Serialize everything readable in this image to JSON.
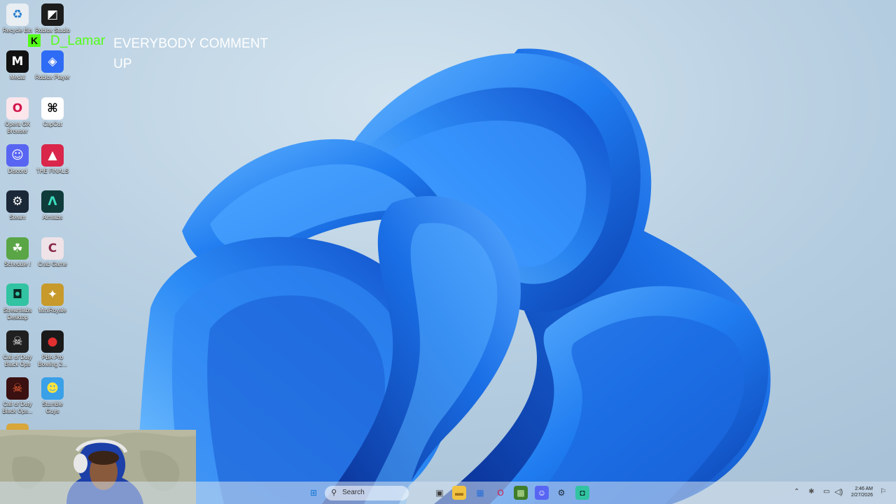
{
  "desktop": {
    "icons": [
      {
        "label": "Recycle Bin",
        "icon": "recycle-bin-icon",
        "glyph": "♻",
        "bg": "#e9eef3",
        "fg": "#2b7fd0"
      },
      {
        "label": "Roblox Studio",
        "icon": "roblox-studio-icon",
        "glyph": "◩",
        "bg": "#1c1c1c",
        "fg": "#ffffff"
      },
      {
        "label": "Medal",
        "icon": "medal-icon",
        "glyph": "M",
        "bg": "#111111",
        "fg": "#ffffff"
      },
      {
        "label": "Roblox Player",
        "icon": "roblox-player-icon",
        "glyph": "◈",
        "bg": "#2f6cf5",
        "fg": "#ffffff"
      },
      {
        "label": "Opera GX Browser",
        "icon": "opera-gx-icon",
        "glyph": "O",
        "bg": "#fbe6ec",
        "fg": "#d3164a"
      },
      {
        "label": "CapCut",
        "icon": "capcut-icon",
        "glyph": "⌘",
        "bg": "#ffffff",
        "fg": "#000000"
      },
      {
        "label": "Discord",
        "icon": "discord-icon",
        "glyph": "☺",
        "bg": "#5865f2",
        "fg": "#ffffff"
      },
      {
        "label": "THE FINALS",
        "icon": "the-finals-icon",
        "glyph": "▲",
        "bg": "#d9264a",
        "fg": "#ffffff"
      },
      {
        "label": "Steam",
        "icon": "steam-icon",
        "glyph": "⚙",
        "bg": "#1b2838",
        "fg": "#ffffff"
      },
      {
        "label": "Aimlabs",
        "icon": "aimlabs-icon",
        "glyph": "Λ",
        "bg": "#103b3b",
        "fg": "#3ce0c0"
      },
      {
        "label": "Schedule I",
        "icon": "schedule-one-icon",
        "glyph": "☘",
        "bg": "#5aa646",
        "fg": "#ffffff"
      },
      {
        "label": "Crab Game",
        "icon": "crab-game-icon",
        "glyph": "C",
        "bg": "#efe3e8",
        "fg": "#8a2a4a"
      },
      {
        "label": "Streamlabs Desktop",
        "icon": "streamlabs-icon",
        "glyph": "◘",
        "bg": "#31c3a2",
        "fg": "#0b2b25"
      },
      {
        "label": "MiniRoyale",
        "icon": "miniroyale-icon",
        "glyph": "✦",
        "bg": "#c79a2b",
        "fg": "#ffffff"
      },
      {
        "label": "Call of Duty Black Ops",
        "icon": "cod-black-ops-icon",
        "glyph": "☠",
        "bg": "#202020",
        "fg": "#ffffff"
      },
      {
        "label": "PBA Pro Bowling 2...",
        "icon": "pba-bowling-icon",
        "glyph": "●",
        "bg": "#1a1a1a",
        "fg": "#e03030"
      },
      {
        "label": "Call of Duty Black Ops...",
        "icon": "cod-black-ops-2-icon",
        "glyph": "☠",
        "bg": "#3a1010",
        "fg": "#ff6a3a"
      },
      {
        "label": "Stumble Guys",
        "icon": "stumble-guys-icon",
        "glyph": "☻",
        "bg": "#3aa0e8",
        "fg": "#ffe43a"
      },
      {
        "label": "",
        "icon": "folder-icon",
        "glyph": "▤",
        "bg": "#d8a63a",
        "fg": "#6b4a0a"
      }
    ]
  },
  "chat": {
    "badge": "K",
    "username": "D_Lamar",
    "message": "EVERYBODY COMMENT UP"
  },
  "taskbar": {
    "search_placeholder": "Search",
    "apps": [
      {
        "name": "start-button",
        "icon": "windows-logo-icon",
        "glyph": "⊞",
        "bg": "transparent",
        "fg": "#1677d6"
      },
      {
        "name": "task-view-button",
        "icon": "task-view-icon",
        "glyph": "▣",
        "bg": "transparent",
        "fg": "#404040"
      },
      {
        "name": "taskbar-file-explorer",
        "icon": "file-explorer-icon",
        "glyph": "▬",
        "bg": "#f2c341",
        "fg": "#a2711a"
      },
      {
        "name": "taskbar-microsoft-store",
        "icon": "microsoft-store-icon",
        "glyph": "▦",
        "bg": "transparent",
        "fg": "#2b6fd6"
      },
      {
        "name": "taskbar-opera-gx",
        "icon": "opera-gx-icon",
        "glyph": "O",
        "bg": "transparent",
        "fg": "#d3164a"
      },
      {
        "name": "taskbar-minecraft",
        "icon": "minecraft-icon",
        "glyph": "▩",
        "bg": "#3f7d2a",
        "fg": "#c7e8a0"
      },
      {
        "name": "taskbar-discord",
        "icon": "discord-icon",
        "glyph": "☺",
        "bg": "#5865f2",
        "fg": "#ffffff"
      },
      {
        "name": "taskbar-steam",
        "icon": "steam-icon",
        "glyph": "⚙",
        "bg": "transparent",
        "fg": "#1b2838"
      },
      {
        "name": "taskbar-streamlabs",
        "icon": "streamlabs-icon",
        "glyph": "◘",
        "bg": "#31c3a2",
        "fg": "#0b2b25"
      }
    ],
    "clock_time": "2:46 AM",
    "clock_date": "2/27/2026"
  }
}
